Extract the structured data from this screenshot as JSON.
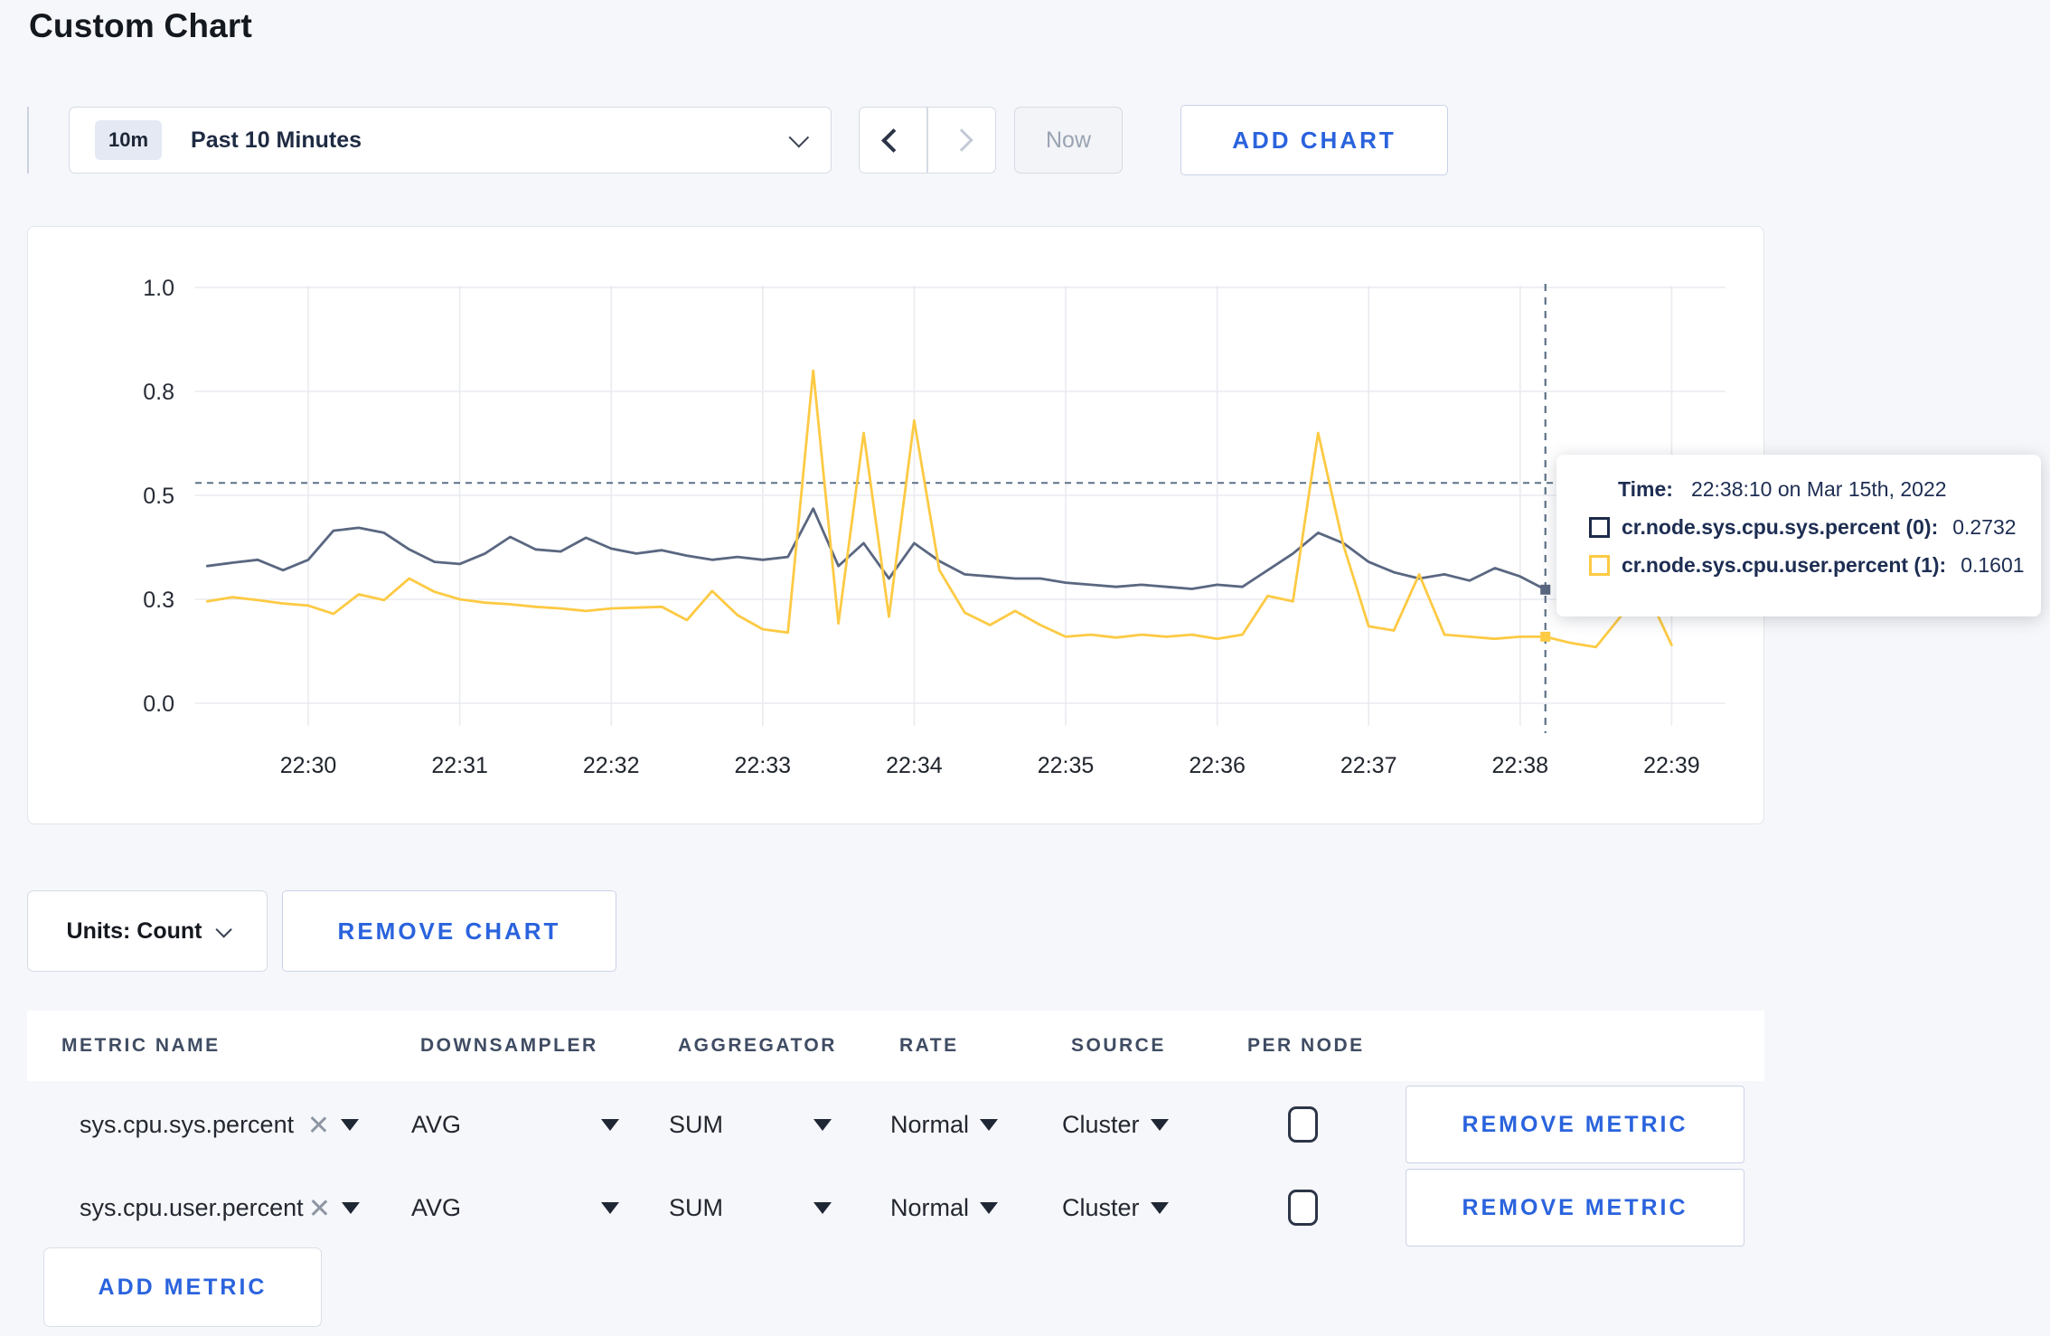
{
  "page": {
    "title": "Custom Chart"
  },
  "colors": {
    "accent_blue": "#2a63dd",
    "series_sys": "#5a6781",
    "series_user": "#fdca44",
    "tooltip_sys_swatch": "#1c2b4a",
    "crosshair": "#5d7187",
    "page_background": "#f6f7fa"
  },
  "icons": [
    "chevron-down",
    "chevron-left",
    "chevron-right",
    "close",
    "dropdown-triangle",
    "checkbox-unchecked"
  ],
  "toolbar": {
    "time_window_badge": "10m",
    "time_window_label": "Past 10 Minutes",
    "now_label": "Now",
    "add_chart_label": "ADD CHART"
  },
  "chart": {
    "units_label": "Units: Count",
    "remove_chart_label": "REMOVE CHART",
    "tooltip": {
      "time_label": "Time:",
      "time_value": "22:38:10 on Mar 15th, 2022",
      "rows": [
        {
          "name": "cr.node.sys.cpu.sys.percent (0):",
          "value": "0.2732",
          "color": "#1c2b4a"
        },
        {
          "name": "cr.node.sys.cpu.user.percent (1):",
          "value": "0.1601",
          "color": "#fdca44"
        }
      ]
    }
  },
  "chart_data": {
    "type": "line",
    "title": "",
    "xlabel": "",
    "ylabel": "",
    "ylim": [
      0,
      1
    ],
    "grid": true,
    "legend_position": "tooltip-on-hover",
    "y_ticks": [
      {
        "value": 0.0,
        "label": "0.0"
      },
      {
        "value": 0.25,
        "label": "0.3"
      },
      {
        "value": 0.5,
        "label": "0.5"
      },
      {
        "value": 0.75,
        "label": "0.8"
      },
      {
        "value": 1.0,
        "label": "1.0"
      }
    ],
    "x_ticks": [
      {
        "offset_sec": 0,
        "label": "22:30"
      },
      {
        "offset_sec": 60,
        "label": "22:31"
      },
      {
        "offset_sec": 120,
        "label": "22:32"
      },
      {
        "offset_sec": 180,
        "label": "22:33"
      },
      {
        "offset_sec": 240,
        "label": "22:34"
      },
      {
        "offset_sec": 300,
        "label": "22:35"
      },
      {
        "offset_sec": 360,
        "label": "22:36"
      },
      {
        "offset_sec": 420,
        "label": "22:37"
      },
      {
        "offset_sec": 480,
        "label": "22:38"
      },
      {
        "offset_sec": 540,
        "label": "22:39"
      }
    ],
    "series": [
      {
        "name": "cr.node.sys.cpu.sys.percent (0)",
        "color": "#5a6781",
        "start_offset_sec": -40,
        "interval_sec": 10,
        "values": [
          0.33,
          0.338,
          0.345,
          0.32,
          0.345,
          0.415,
          0.422,
          0.41,
          0.37,
          0.34,
          0.335,
          0.36,
          0.4,
          0.37,
          0.365,
          0.398,
          0.372,
          0.36,
          0.368,
          0.355,
          0.345,
          0.352,
          0.345,
          0.352,
          0.468,
          0.33,
          0.385,
          0.3,
          0.385,
          0.342,
          0.31,
          0.305,
          0.3,
          0.3,
          0.29,
          0.285,
          0.28,
          0.285,
          0.28,
          0.275,
          0.285,
          0.28,
          0.32,
          0.36,
          0.41,
          0.385,
          0.34,
          0.315,
          0.3,
          0.31,
          0.295,
          0.325,
          0.305,
          0.2732
        ]
      },
      {
        "name": "cr.node.sys.cpu.user.percent (1)",
        "color": "#fdca44",
        "start_offset_sec": -40,
        "interval_sec": 10,
        "values": [
          0.245,
          0.255,
          0.248,
          0.24,
          0.235,
          0.215,
          0.262,
          0.248,
          0.3,
          0.268,
          0.25,
          0.242,
          0.238,
          0.232,
          0.228,
          0.222,
          0.228,
          0.23,
          0.232,
          0.2,
          0.27,
          0.212,
          0.178,
          0.17,
          0.8,
          0.192,
          0.65,
          0.208,
          0.68,
          0.32,
          0.218,
          0.188,
          0.222,
          0.188,
          0.16,
          0.165,
          0.158,
          0.165,
          0.16,
          0.165,
          0.155,
          0.165,
          0.258,
          0.245,
          0.65,
          0.38,
          0.185,
          0.175,
          0.31,
          0.165,
          0.16,
          0.155,
          0.16,
          0.1601,
          0.145,
          0.135,
          0.21,
          0.27,
          0.14
        ]
      }
    ],
    "crosshair": {
      "offset_sec": 490,
      "time": "22:38:10 on Mar 15th, 2022",
      "guideline_value": 0.53,
      "markers": [
        {
          "series": 0,
          "value": 0.2732
        },
        {
          "series": 1,
          "value": 0.1601
        }
      ]
    }
  },
  "metrics_table": {
    "headers": [
      "METRIC NAME",
      "DOWNSAMPLER",
      "AGGREGATOR",
      "RATE",
      "SOURCE",
      "PER NODE"
    ],
    "rows": [
      {
        "metric": "sys.cpu.sys.percent",
        "downsampler": "AVG",
        "aggregator": "SUM",
        "rate": "Normal",
        "source": "Cluster",
        "per_node_checked": false,
        "remove_label": "REMOVE METRIC"
      },
      {
        "metric": "sys.cpu.user.percent",
        "downsampler": "AVG",
        "aggregator": "SUM",
        "rate": "Normal",
        "source": "Cluster",
        "per_node_checked": false,
        "remove_label": "REMOVE METRIC"
      }
    ],
    "add_metric_label": "ADD METRIC"
  }
}
